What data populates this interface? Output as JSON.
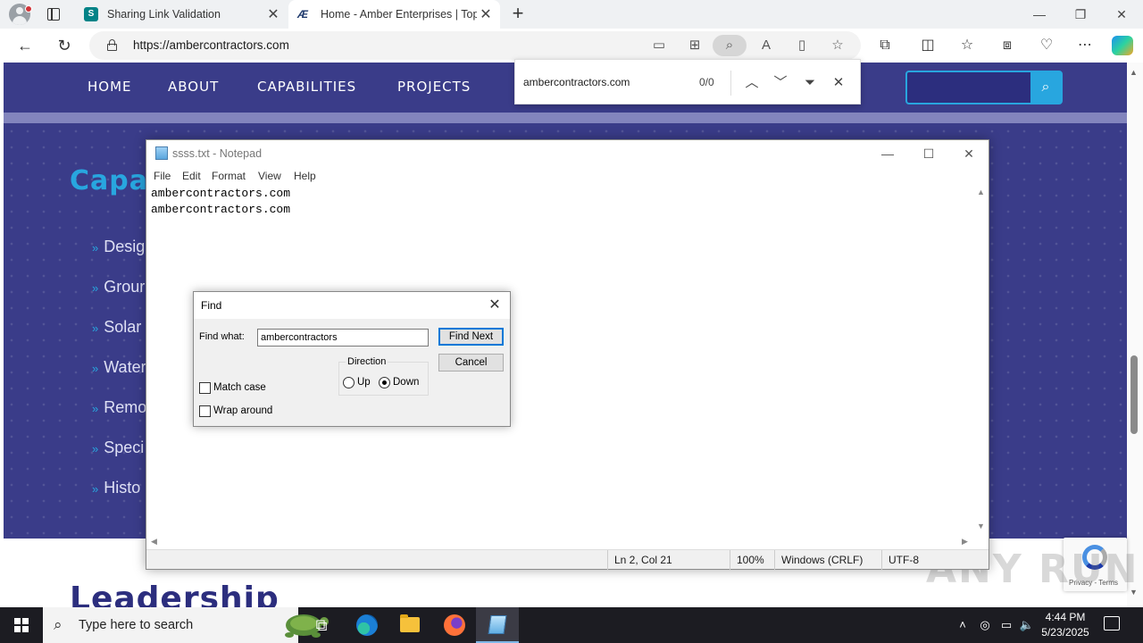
{
  "browser": {
    "tabs": [
      {
        "title": "Sharing Link Validation",
        "favicon": "sharepoint-icon",
        "active": false
      },
      {
        "title": "Home - Amber Enterprises | Top-",
        "favicon": "amber-logo-icon",
        "active": true
      }
    ],
    "new_tab": "+",
    "url": "https://ambercontractors.com",
    "find_bar": {
      "query": "ambercontractors.com",
      "count": "0/0"
    }
  },
  "website": {
    "nav": [
      "HOME",
      "ABOUT",
      "CAPABILITIES",
      "PROJECTS"
    ],
    "heading_partial": "Capa",
    "items": [
      "Desig",
      "Grour",
      "Solar",
      "Water",
      "Remo",
      "Speci",
      "Histo"
    ],
    "leadership_partial": "Leadership",
    "recaptcha": "Privacy - Terms",
    "watermark": "ANY RUN"
  },
  "notepad": {
    "title": "ssss.txt - Notepad",
    "menu": [
      "File",
      "Edit",
      "Format",
      "View",
      "Help"
    ],
    "lines": [
      "ambercontractors.com",
      "ambercontractors.com"
    ],
    "status": {
      "position": "Ln 2, Col 21",
      "zoom": "100%",
      "line_ending": "Windows (CRLF)",
      "encoding": "UTF-8"
    }
  },
  "find_dialog": {
    "title": "Find",
    "find_what_label": "Find what:",
    "find_what_value": "ambercontractors",
    "find_next": "Find Next",
    "cancel": "Cancel",
    "direction_label": "Direction",
    "up": "Up",
    "down": "Down",
    "direction_selected": "Down",
    "match_case": "Match case",
    "match_case_checked": false,
    "wrap_around": "Wrap around",
    "wrap_around_checked": false
  },
  "taskbar": {
    "search_placeholder": "Type here to search",
    "time": "4:44 PM",
    "date": "5/23/2025",
    "apps": [
      "task-view-icon",
      "edge-icon",
      "file-explorer-icon",
      "firefox-icon",
      "notepad-icon"
    ],
    "active_app": "notepad-icon"
  },
  "colors": {
    "site_nav": "#3a3c89",
    "site_accent": "#28a6df",
    "taskbar": "#1c1c22"
  }
}
